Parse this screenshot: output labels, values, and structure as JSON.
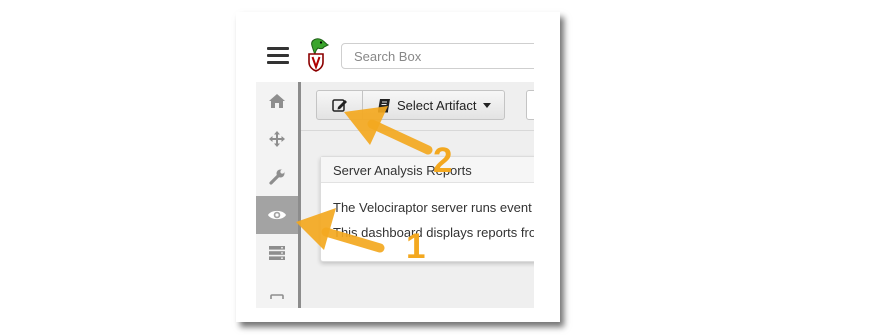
{
  "search": {
    "placeholder": "Search Box"
  },
  "sidebar": {
    "items": [
      {
        "id": "home",
        "icon": "home-icon"
      },
      {
        "id": "hunt",
        "icon": "crosshairs-icon"
      },
      {
        "id": "tools",
        "icon": "wrench-icon"
      },
      {
        "id": "view",
        "icon": "eye-icon",
        "active": true
      },
      {
        "id": "servers",
        "icon": "server-icon"
      },
      {
        "id": "more",
        "icon": "square-icon"
      }
    ]
  },
  "toolbar": {
    "edit_icon": "edit-icon",
    "book_icon": "book-icon",
    "select_artifact_label": "Select Artifact"
  },
  "card": {
    "title": "Server Analysis Reports",
    "line1": "The Velociraptor server runs event",
    "line2": "This dashboard displays reports fro"
  },
  "annotations": {
    "marker_1": "1",
    "marker_2": "2",
    "color": "#f3a820"
  },
  "colors": {
    "active_sidebar": "#a3a3a3",
    "sidebar_bg": "#f3f3f3",
    "content_bg": "#efefef"
  }
}
